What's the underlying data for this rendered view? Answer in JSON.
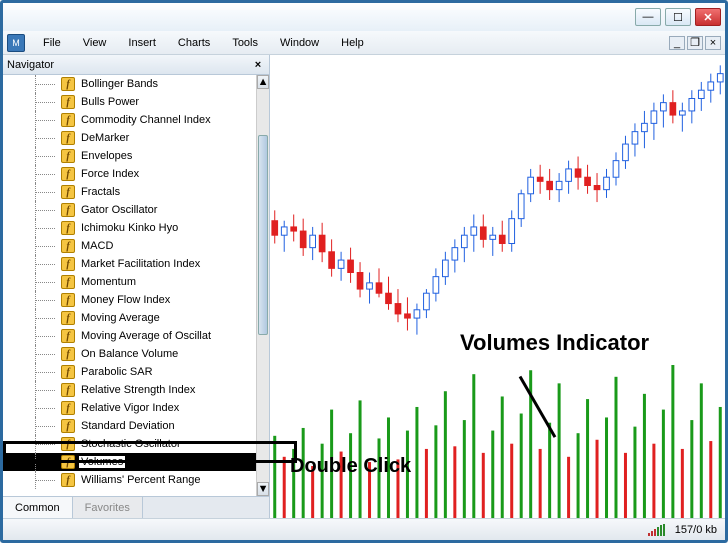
{
  "titlebar": {
    "min": "—",
    "max": "☐",
    "close": "✕"
  },
  "menubar": {
    "items": [
      "File",
      "View",
      "Insert",
      "Charts",
      "Tools",
      "Window",
      "Help"
    ],
    "mdi": {
      "min": "_",
      "restore": "❐",
      "close": "×"
    }
  },
  "navigator": {
    "title": "Navigator",
    "close": "×",
    "indicators": [
      "Bollinger Bands",
      "Bulls Power",
      "Commodity Channel Index",
      "DeMarker",
      "Envelopes",
      "Force Index",
      "Fractals",
      "Gator Oscillator",
      "Ichimoku Kinko Hyo",
      "MACD",
      "Market Facilitation Index",
      "Momentum",
      "Money Flow Index",
      "Moving Average",
      "Moving Average of Oscillat",
      "On Balance Volume",
      "Parabolic SAR",
      "Relative Strength Index",
      "Relative Vigor Index",
      "Standard Deviation",
      "Stochastic Oscillator",
      "Volumes",
      "Williams' Percent Range"
    ],
    "selected": "Volumes",
    "tabs": {
      "common": "Common",
      "favorites": "Favorites"
    },
    "scroll": {
      "up": "▲",
      "down": "▼"
    }
  },
  "annotations": {
    "title": "Volumes Indicator",
    "hint": "Double Click"
  },
  "statusbar": {
    "transfer": "157/0 kb"
  },
  "chart_data": {
    "type": "candlestick",
    "series": [
      {
        "o": 115,
        "h": 120,
        "l": 104,
        "c": 108
      },
      {
        "o": 108,
        "h": 115,
        "l": 100,
        "c": 112
      },
      {
        "o": 112,
        "h": 118,
        "l": 105,
        "c": 110
      },
      {
        "o": 110,
        "h": 116,
        "l": 98,
        "c": 102
      },
      {
        "o": 102,
        "h": 112,
        "l": 96,
        "c": 108
      },
      {
        "o": 108,
        "h": 114,
        "l": 95,
        "c": 100
      },
      {
        "o": 100,
        "h": 106,
        "l": 88,
        "c": 92
      },
      {
        "o": 92,
        "h": 100,
        "l": 86,
        "c": 96
      },
      {
        "o": 96,
        "h": 102,
        "l": 85,
        "c": 90
      },
      {
        "o": 90,
        "h": 95,
        "l": 78,
        "c": 82
      },
      {
        "o": 82,
        "h": 90,
        "l": 75,
        "c": 85
      },
      {
        "o": 85,
        "h": 92,
        "l": 78,
        "c": 80
      },
      {
        "o": 80,
        "h": 88,
        "l": 72,
        "c": 75
      },
      {
        "o": 75,
        "h": 82,
        "l": 66,
        "c": 70
      },
      {
        "o": 70,
        "h": 78,
        "l": 62,
        "c": 68
      },
      {
        "o": 68,
        "h": 75,
        "l": 60,
        "c": 72
      },
      {
        "o": 72,
        "h": 82,
        "l": 68,
        "c": 80
      },
      {
        "o": 80,
        "h": 92,
        "l": 76,
        "c": 88
      },
      {
        "o": 88,
        "h": 100,
        "l": 84,
        "c": 96
      },
      {
        "o": 96,
        "h": 106,
        "l": 90,
        "c": 102
      },
      {
        "o": 102,
        "h": 112,
        "l": 95,
        "c": 108
      },
      {
        "o": 108,
        "h": 118,
        "l": 100,
        "c": 112
      },
      {
        "o": 112,
        "h": 118,
        "l": 102,
        "c": 106
      },
      {
        "o": 106,
        "h": 112,
        "l": 98,
        "c": 108
      },
      {
        "o": 108,
        "h": 115,
        "l": 100,
        "c": 104
      },
      {
        "o": 104,
        "h": 120,
        "l": 100,
        "c": 116
      },
      {
        "o": 116,
        "h": 130,
        "l": 112,
        "c": 128
      },
      {
        "o": 128,
        "h": 140,
        "l": 124,
        "c": 136
      },
      {
        "o": 136,
        "h": 142,
        "l": 128,
        "c": 134
      },
      {
        "o": 134,
        "h": 140,
        "l": 125,
        "c": 130
      },
      {
        "o": 130,
        "h": 138,
        "l": 124,
        "c": 134
      },
      {
        "o": 134,
        "h": 144,
        "l": 128,
        "c": 140
      },
      {
        "o": 140,
        "h": 146,
        "l": 130,
        "c": 136
      },
      {
        "o": 136,
        "h": 142,
        "l": 128,
        "c": 132
      },
      {
        "o": 132,
        "h": 138,
        "l": 124,
        "c": 130
      },
      {
        "o": 130,
        "h": 140,
        "l": 126,
        "c": 136
      },
      {
        "o": 136,
        "h": 148,
        "l": 132,
        "c": 144
      },
      {
        "o": 144,
        "h": 156,
        "l": 140,
        "c": 152
      },
      {
        "o": 152,
        "h": 162,
        "l": 146,
        "c": 158
      },
      {
        "o": 158,
        "h": 168,
        "l": 150,
        "c": 162
      },
      {
        "o": 162,
        "h": 172,
        "l": 154,
        "c": 168
      },
      {
        "o": 168,
        "h": 176,
        "l": 160,
        "c": 172
      },
      {
        "o": 172,
        "h": 178,
        "l": 162,
        "c": 166
      },
      {
        "o": 166,
        "h": 172,
        "l": 158,
        "c": 168
      },
      {
        "o": 168,
        "h": 178,
        "l": 162,
        "c": 174
      },
      {
        "o": 174,
        "h": 182,
        "l": 168,
        "c": 178
      },
      {
        "o": 178,
        "h": 186,
        "l": 172,
        "c": 182
      },
      {
        "o": 182,
        "h": 190,
        "l": 176,
        "c": 186
      }
    ],
    "ymin": 55,
    "ymax": 195
  },
  "volume_data": {
    "type": "bar",
    "values": [
      68,
      52,
      58,
      74,
      45,
      62,
      88,
      56,
      70,
      95,
      48,
      66,
      82,
      50,
      72,
      90,
      58,
      76,
      102,
      60,
      80,
      115,
      55,
      72,
      98,
      62,
      85,
      118,
      58,
      78,
      108,
      52,
      70,
      96,
      65,
      82,
      113,
      55,
      75,
      100,
      62,
      88,
      122,
      58,
      80,
      108,
      64,
      90
    ]
  }
}
